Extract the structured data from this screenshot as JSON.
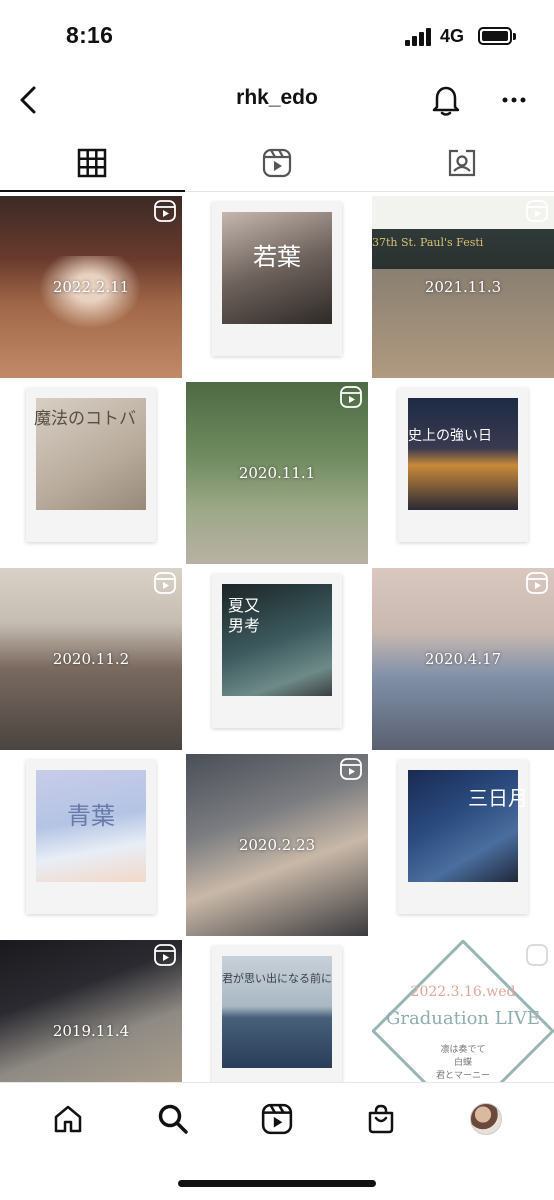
{
  "status": {
    "time": "8:16",
    "network": "4G"
  },
  "header": {
    "username": "rhk_edo"
  },
  "tabs": [
    {
      "name": "grid",
      "icon": "grid-icon",
      "active": true
    },
    {
      "name": "reels",
      "icon": "reels-icon",
      "active": false
    },
    {
      "name": "tagged",
      "icon": "tagged-icon",
      "active": false
    }
  ],
  "posts": [
    {
      "type": "photo",
      "caption": "2022.2.11",
      "reel": true
    },
    {
      "type": "polaroid",
      "title": "若葉",
      "reel": false
    },
    {
      "type": "photo",
      "caption": "2021.11.3",
      "banner": "37th St. Paul's Festi",
      "reel": true
    },
    {
      "type": "polaroid",
      "title": "魔法のコトバ",
      "reel": false
    },
    {
      "type": "photo",
      "caption": "2020.11.1",
      "reel": true
    },
    {
      "type": "polaroid",
      "title": "史上の強い日",
      "reel": false
    },
    {
      "type": "photo",
      "caption": "2020.11.2",
      "reel": true
    },
    {
      "type": "polaroid",
      "title": "夏又男考",
      "reel": false
    },
    {
      "type": "photo",
      "caption": "2020.4.17",
      "reel": true
    },
    {
      "type": "polaroid",
      "title": "青葉",
      "reel": false
    },
    {
      "type": "photo",
      "caption": "2020.2.23",
      "reel": true
    },
    {
      "type": "polaroid",
      "title": "三日月",
      "reel": false
    },
    {
      "type": "photo",
      "caption": "2019.11.4",
      "reel": true
    },
    {
      "type": "polaroid",
      "title": "君が思い出になる前に",
      "reel": false
    },
    {
      "type": "graduation",
      "date": "2022.3.16.wed",
      "title": "Graduation LIVE",
      "songs": [
        "凛は奏でて",
        "白蝶",
        "君とマーニー"
      ],
      "reel": true
    }
  ],
  "bottom_nav": [
    "home-icon",
    "search-icon",
    "reels-icon",
    "shop-icon",
    "profile-avatar"
  ],
  "colors": {
    "text": "#111111",
    "divider": "#e4e4e4",
    "graduation_accent": "#9ab5b5",
    "graduation_date": "#e0a59c"
  }
}
